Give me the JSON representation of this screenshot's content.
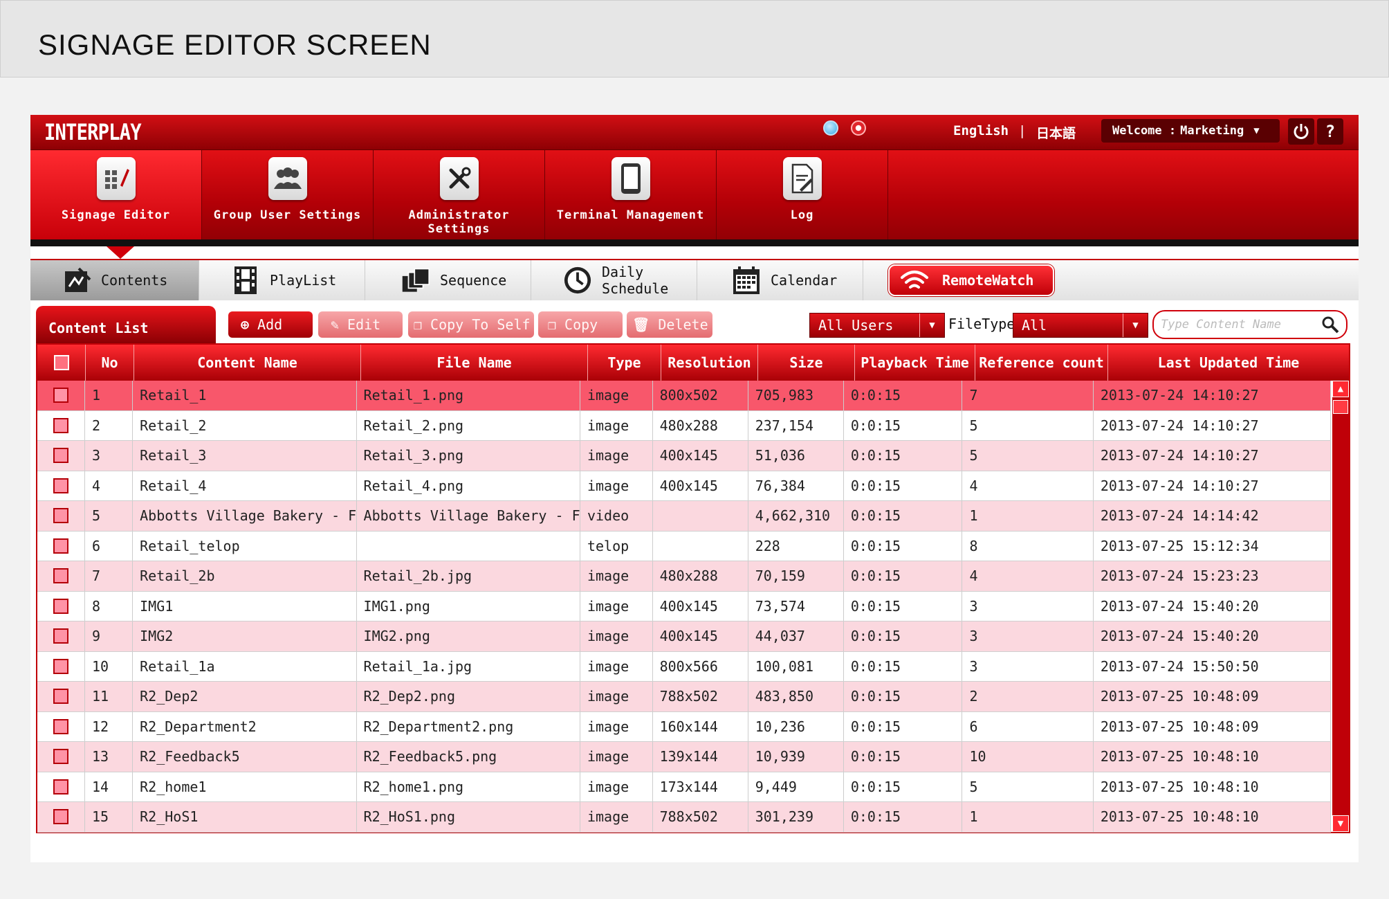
{
  "page_title": "SIGNAGE EDITOR SCREEN",
  "topbar": {
    "brand": "INTERPLAY",
    "lang_en": "English",
    "lang_sep": "|",
    "lang_ja": "日本語",
    "welcome_label": "Welcome :",
    "welcome_user": "Marketing",
    "power_icon": "power-icon",
    "help_label": "?"
  },
  "mainnav": [
    {
      "label": "Signage Editor",
      "icon": "grid-pencil-icon",
      "active": true
    },
    {
      "label": "Group User Settings",
      "icon": "users-icon",
      "active": false
    },
    {
      "label": "Administrator Settings",
      "icon": "tools-icon",
      "active": false
    },
    {
      "label": "Terminal Management",
      "icon": "tablet-icon",
      "active": false
    },
    {
      "label": "Log",
      "icon": "log-icon",
      "active": false
    }
  ],
  "tabs": [
    {
      "label": "Contents",
      "icon": "contents-icon",
      "active": true
    },
    {
      "label": "PlayList",
      "icon": "film-icon",
      "active": false
    },
    {
      "label": "Sequence",
      "icon": "sequence-icon",
      "active": false
    },
    {
      "label": "Daily Schedule",
      "icon": "clock-icon",
      "active": false
    },
    {
      "label": "Calendar",
      "icon": "calendar-icon",
      "active": false
    }
  ],
  "remotewatch": {
    "label": "RemoteWatch",
    "icon": "wifi-icon"
  },
  "toolbar": {
    "list_title": "Content List",
    "add": "Add",
    "edit": "Edit",
    "copy_to_self": "Copy To Self",
    "copy": "Copy",
    "delete": "Delete",
    "users_filter": "All Users",
    "filetype_label": "FileType",
    "filetype_value": "All",
    "search_placeholder": "Type Content Name"
  },
  "table": {
    "columns": [
      "No",
      "Content Name",
      "File Name",
      "Type",
      "Resolution",
      "Size",
      "Playback Time",
      "Reference count",
      "Last Updated Time"
    ],
    "rows": [
      [
        "1",
        "Retail_1",
        "Retail_1.png",
        "image",
        "800x502",
        "705,983",
        "0:0:15",
        "7",
        "2013-07-24 14:10:27"
      ],
      [
        "2",
        "Retail_2",
        "Retail_2.png",
        "image",
        "480x288",
        "237,154",
        "0:0:15",
        "5",
        "2013-07-24 14:10:27"
      ],
      [
        "3",
        "Retail_3",
        "Retail_3.png",
        "image",
        "400x145",
        "51,036",
        "0:0:15",
        "5",
        "2013-07-24 14:10:27"
      ],
      [
        "4",
        "Retail_4",
        "Retail_4.png",
        "image",
        "400x145",
        "76,384",
        "0:0:15",
        "4",
        "2013-07-24 14:10:27"
      ],
      [
        "5",
        "Abbotts Village Bakery - Free",
        "Abbotts Village Bakery - Free",
        "video",
        "",
        "4,662,310",
        "0:0:15",
        "1",
        "2013-07-24 14:14:42"
      ],
      [
        "6",
        "Retail_telop",
        "",
        "telop",
        "",
        "228",
        "0:0:15",
        "8",
        "2013-07-25 15:12:34"
      ],
      [
        "7",
        "Retail_2b",
        "Retail_2b.jpg",
        "image",
        "480x288",
        "70,159",
        "0:0:15",
        "4",
        "2013-07-24 15:23:23"
      ],
      [
        "8",
        "IMG1",
        "IMG1.png",
        "image",
        "400x145",
        "73,574",
        "0:0:15",
        "3",
        "2013-07-24 15:40:20"
      ],
      [
        "9",
        "IMG2",
        "IMG2.png",
        "image",
        "400x145",
        "44,037",
        "0:0:15",
        "3",
        "2013-07-24 15:40:20"
      ],
      [
        "10",
        "Retail_1a",
        "Retail_1a.jpg",
        "image",
        "800x566",
        "100,081",
        "0:0:15",
        "3",
        "2013-07-24 15:50:50"
      ],
      [
        "11",
        "R2_Dep2",
        "R2_Dep2.png",
        "image",
        "788x502",
        "483,850",
        "0:0:15",
        "2",
        "2013-07-25 10:48:09"
      ],
      [
        "12",
        "R2_Department2",
        "R2_Department2.png",
        "image",
        "160x144",
        "10,236",
        "0:0:15",
        "6",
        "2013-07-25 10:48:09"
      ],
      [
        "13",
        "R2_Feedback5",
        "R2_Feedback5.png",
        "image",
        "139x144",
        "10,939",
        "0:0:15",
        "10",
        "2013-07-25 10:48:10"
      ],
      [
        "14",
        "R2_home1",
        "R2_home1.png",
        "image",
        "173x144",
        "9,449",
        "0:0:15",
        "5",
        "2013-07-25 10:48:10"
      ],
      [
        "15",
        "R2_HoS1",
        "R2_HoS1.png",
        "image",
        "788x502",
        "301,239",
        "0:0:15",
        "1",
        "2013-07-25 10:48:10"
      ]
    ],
    "selected_row_index": 0
  },
  "colors": {
    "accent": "#d0000a",
    "row_alt": "#fbd8df",
    "row_selected": "#f8576b"
  }
}
